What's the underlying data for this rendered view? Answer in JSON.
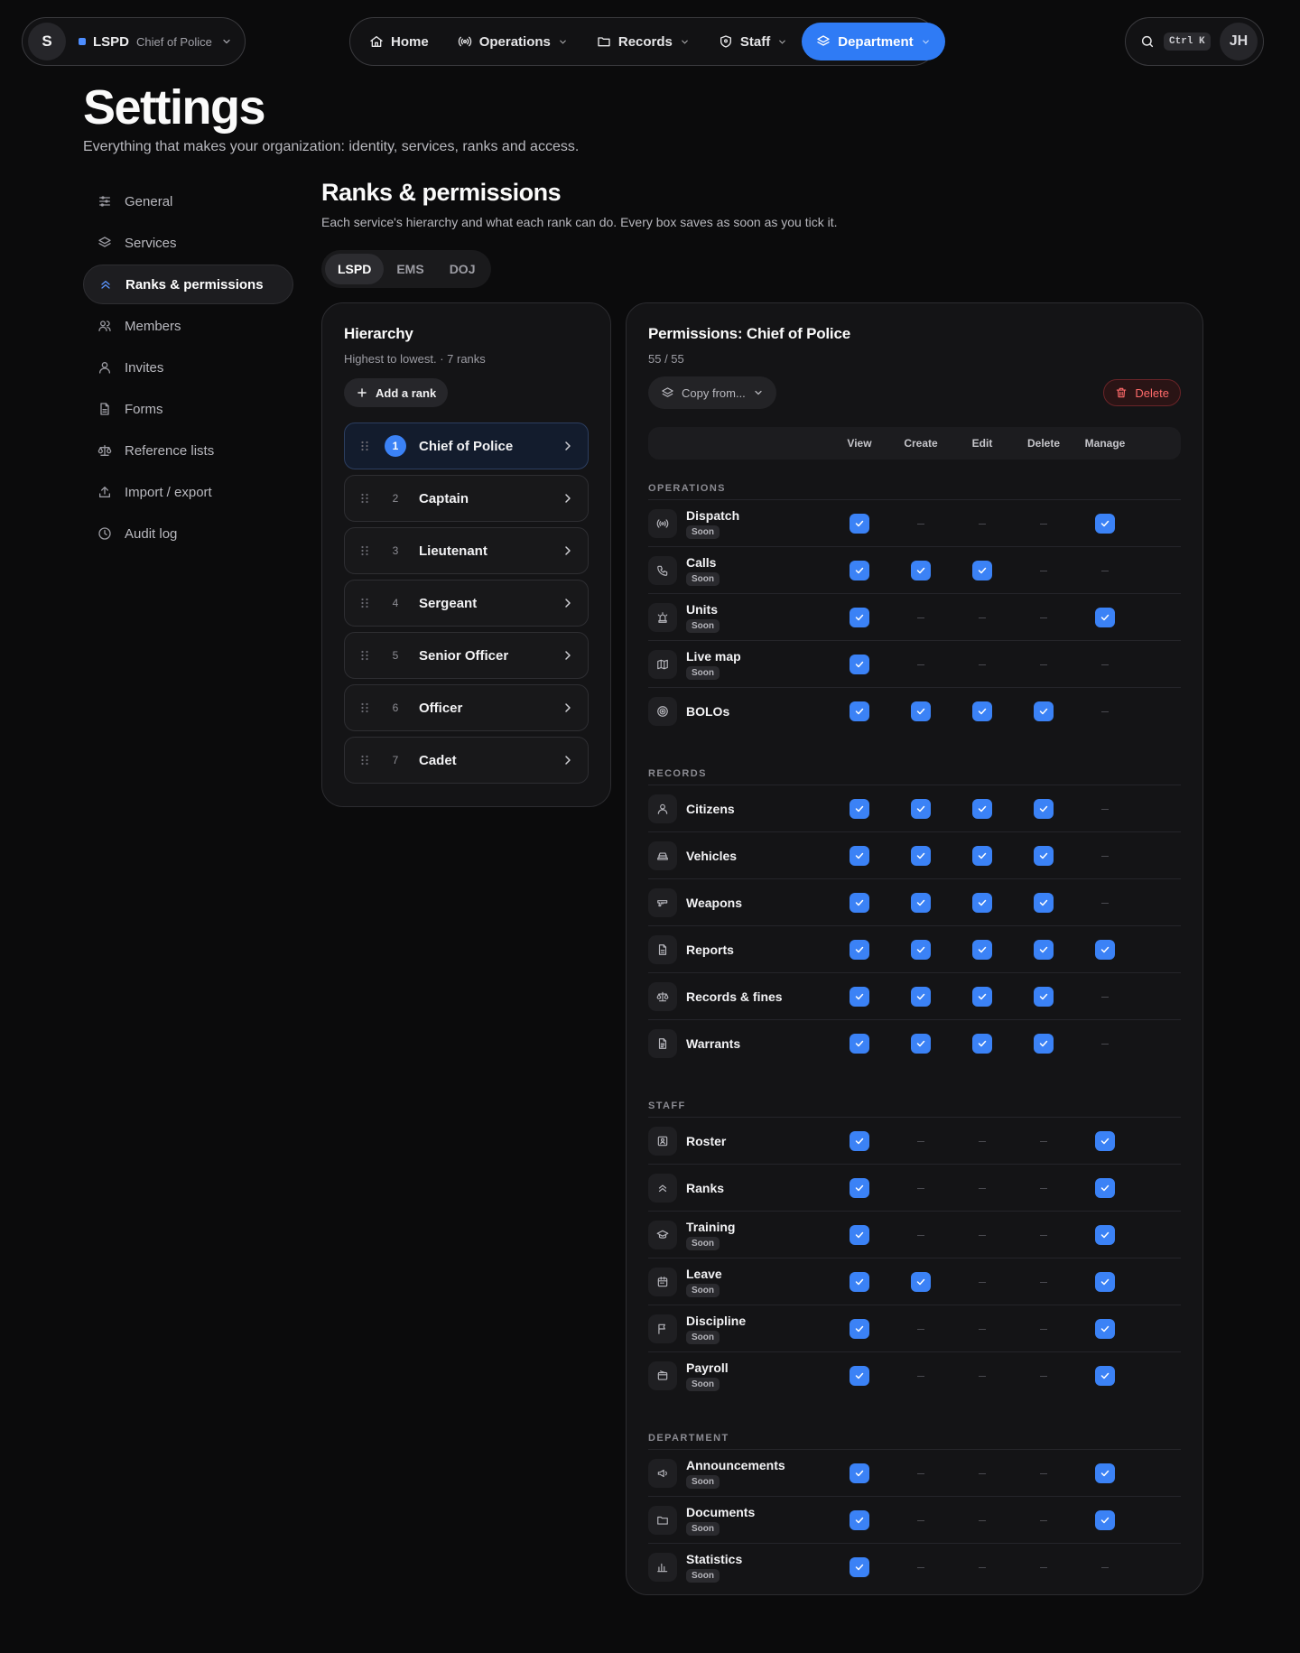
{
  "org": {
    "initial": "S",
    "name": "LSPD",
    "role": "Chief of Police"
  },
  "nav": [
    {
      "label": "Home",
      "icon": "home-icon",
      "chevron": false,
      "active": false
    },
    {
      "label": "Operations",
      "icon": "broadcast-icon",
      "chevron": true,
      "active": false
    },
    {
      "label": "Records",
      "icon": "folder-icon",
      "chevron": true,
      "active": false
    },
    {
      "label": "Staff",
      "icon": "shield-icon",
      "chevron": true,
      "active": false
    },
    {
      "label": "Department",
      "icon": "layers-icon",
      "chevron": true,
      "active": true
    }
  ],
  "search": {
    "shortcut": "Ctrl K"
  },
  "user": {
    "initials": "JH"
  },
  "page": {
    "title": "Settings",
    "subtitle": "Everything that makes your organization: identity, services, ranks and access."
  },
  "sidebar": [
    {
      "label": "General",
      "icon": "sliders-icon",
      "active": false
    },
    {
      "label": "Services",
      "icon": "layers-icon",
      "active": false
    },
    {
      "label": "Ranks & permissions",
      "icon": "chevrons-up-icon",
      "active": true
    },
    {
      "label": "Members",
      "icon": "users-icon",
      "active": false
    },
    {
      "label": "Invites",
      "icon": "user-icon",
      "active": false
    },
    {
      "label": "Forms",
      "icon": "file-icon",
      "active": false
    },
    {
      "label": "Reference lists",
      "icon": "scale-icon",
      "active": false
    },
    {
      "label": "Import / export",
      "icon": "upload-icon",
      "active": false
    },
    {
      "label": "Audit log",
      "icon": "clock-icon",
      "active": false
    }
  ],
  "section": {
    "title": "Ranks & permissions",
    "subtitle": "Each service's hierarchy and what each rank can do. Every box saves as soon as you tick it.",
    "services": [
      "LSPD",
      "EMS",
      "DOJ"
    ],
    "active_service": "LSPD"
  },
  "hierarchy": {
    "title": "Hierarchy",
    "subtitle": "Highest to lowest. · 7 ranks",
    "add_label": "Add a rank",
    "ranks": [
      {
        "num": "1",
        "name": "Chief of Police",
        "active": true
      },
      {
        "num": "2",
        "name": "Captain",
        "active": false
      },
      {
        "num": "3",
        "name": "Lieutenant",
        "active": false
      },
      {
        "num": "4",
        "name": "Sergeant",
        "active": false
      },
      {
        "num": "5",
        "name": "Senior Officer",
        "active": false
      },
      {
        "num": "6",
        "name": "Officer",
        "active": false
      },
      {
        "num": "7",
        "name": "Cadet",
        "active": false
      }
    ]
  },
  "permissions": {
    "title": "Permissions: Chief of Police",
    "count": "55 / 55",
    "copy_label": "Copy from...",
    "delete_label": "Delete",
    "soon_label": "Soon",
    "columns": [
      "View",
      "Create",
      "Edit",
      "Delete",
      "Manage"
    ],
    "check_color": "#3b82f6",
    "groups": [
      {
        "label": "OPERATIONS",
        "rows": [
          {
            "name": "Dispatch",
            "icon": "broadcast-icon",
            "soon": true,
            "perms": [
              1,
              0,
              0,
              0,
              1
            ]
          },
          {
            "name": "Calls",
            "icon": "phone-icon",
            "soon": true,
            "perms": [
              1,
              1,
              1,
              0,
              0
            ]
          },
          {
            "name": "Units",
            "icon": "siren-icon",
            "soon": true,
            "perms": [
              1,
              0,
              0,
              0,
              1
            ]
          },
          {
            "name": "Live map",
            "icon": "map-icon",
            "soon": true,
            "perms": [
              1,
              0,
              0,
              0,
              0
            ]
          },
          {
            "name": "BOLOs",
            "icon": "target-icon",
            "soon": false,
            "perms": [
              1,
              1,
              1,
              1,
              0
            ]
          }
        ]
      },
      {
        "label": "RECORDS",
        "rows": [
          {
            "name": "Citizens",
            "icon": "user-icon",
            "soon": false,
            "perms": [
              1,
              1,
              1,
              1,
              0
            ]
          },
          {
            "name": "Vehicles",
            "icon": "car-icon",
            "soon": false,
            "perms": [
              1,
              1,
              1,
              1,
              0
            ]
          },
          {
            "name": "Weapons",
            "icon": "gun-icon",
            "soon": false,
            "perms": [
              1,
              1,
              1,
              1,
              0
            ]
          },
          {
            "name": "Reports",
            "icon": "file-icon",
            "soon": false,
            "perms": [
              1,
              1,
              1,
              1,
              1
            ]
          },
          {
            "name": "Records & fines",
            "icon": "scale-icon",
            "soon": false,
            "perms": [
              1,
              1,
              1,
              1,
              0
            ]
          },
          {
            "name": "Warrants",
            "icon": "file-text-icon",
            "soon": false,
            "perms": [
              1,
              1,
              1,
              1,
              0
            ]
          }
        ]
      },
      {
        "label": "STAFF",
        "rows": [
          {
            "name": "Roster",
            "icon": "id-card-icon",
            "soon": false,
            "perms": [
              1,
              0,
              0,
              0,
              1
            ]
          },
          {
            "name": "Ranks",
            "icon": "chevrons-up-icon",
            "soon": false,
            "perms": [
              1,
              0,
              0,
              0,
              1
            ]
          },
          {
            "name": "Training",
            "icon": "graduation-cap-icon",
            "soon": true,
            "perms": [
              1,
              0,
              0,
              0,
              1
            ]
          },
          {
            "name": "Leave",
            "icon": "calendar-icon",
            "soon": true,
            "perms": [
              1,
              1,
              0,
              0,
              1
            ]
          },
          {
            "name": "Discipline",
            "icon": "flag-icon",
            "soon": true,
            "perms": [
              1,
              0,
              0,
              0,
              1
            ]
          },
          {
            "name": "Payroll",
            "icon": "wallet-icon",
            "soon": true,
            "perms": [
              1,
              0,
              0,
              0,
              1
            ]
          }
        ]
      },
      {
        "label": "DEPARTMENT",
        "rows": [
          {
            "name": "Announcements",
            "icon": "megaphone-icon",
            "soon": true,
            "perms": [
              1,
              0,
              0,
              0,
              1
            ]
          },
          {
            "name": "Documents",
            "icon": "folder-icon",
            "soon": true,
            "perms": [
              1,
              0,
              0,
              0,
              1
            ]
          },
          {
            "name": "Statistics",
            "icon": "bar-chart-icon",
            "soon": true,
            "perms": [
              1,
              0,
              0,
              0,
              0
            ]
          }
        ]
      }
    ]
  }
}
